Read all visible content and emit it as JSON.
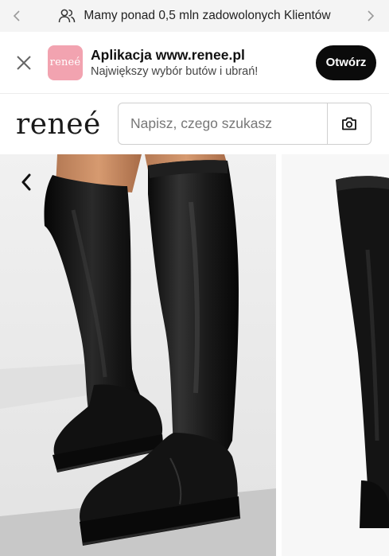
{
  "announcement": {
    "text": "Mamy ponad 0,5 mln zadowolonych Klientów",
    "icon": "users-icon",
    "prev_icon": "chevron-left-icon",
    "next_icon": "chevron-right-icon"
  },
  "app_banner": {
    "logo_text": "reneé",
    "title": "Aplikacja www.renee.pl",
    "subtitle": "Największy wybór butów i ubrań!",
    "open_label": "Otwórz",
    "close_icon": "close-icon",
    "logo_color": "#f2a3b0"
  },
  "header": {
    "brand": "reneé",
    "search_placeholder": "Napisz, czego szukasz",
    "camera_icon": "camera-icon"
  },
  "gallery": {
    "back_icon": "chevron-left-icon",
    "image_subject": "black over-the-knee boots"
  },
  "colors": {
    "announcement_bg": "#f4f4f4",
    "button_bg": "#0b0b0b",
    "boot": "#111111",
    "floor": "#c9c9c9",
    "wall": "#e9e9e9"
  }
}
